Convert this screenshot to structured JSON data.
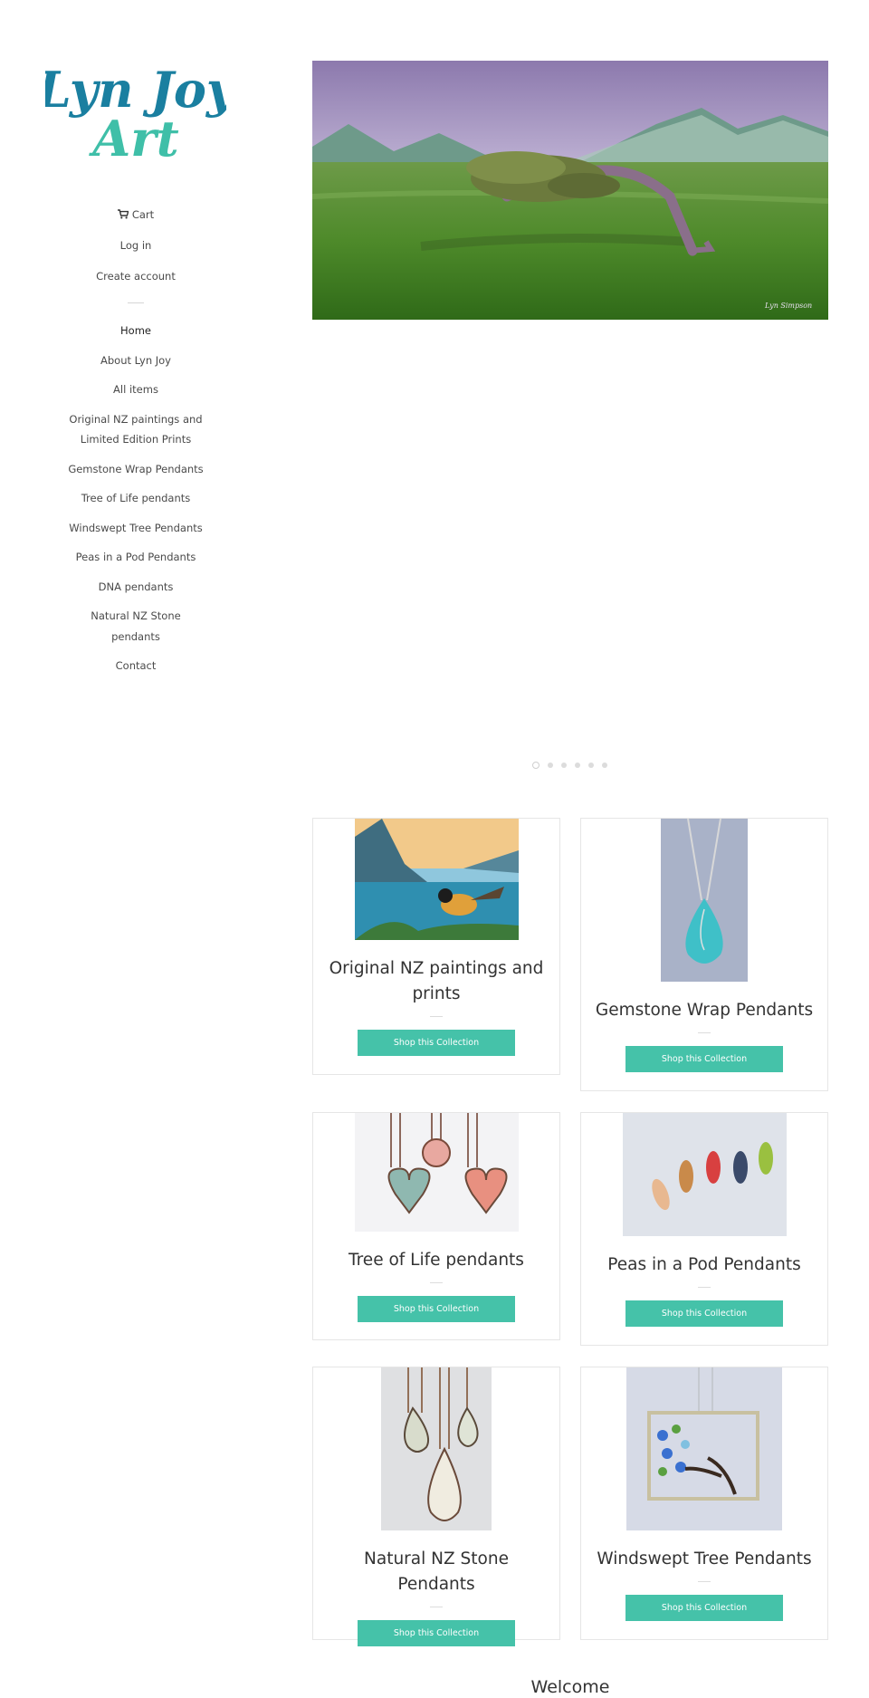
{
  "logo": {
    "line1": "Lyn Joy",
    "line2": "Art"
  },
  "account_links": [
    {
      "label": "Cart",
      "icon": "cart-icon"
    },
    {
      "label": "Log in"
    },
    {
      "label": "Create account"
    }
  ],
  "nav": [
    {
      "label": "Home",
      "active": true
    },
    {
      "label": "About Lyn Joy"
    },
    {
      "label": "All items"
    },
    {
      "label": "Original NZ paintings and Limited Edition Prints"
    },
    {
      "label": "Gemstone Wrap Pendants"
    },
    {
      "label": "Tree of Life pendants"
    },
    {
      "label": "Windswept Tree Pendants"
    },
    {
      "label": "Peas in a Pod Pendants"
    },
    {
      "label": "DNA pendants"
    },
    {
      "label": "Natural NZ Stone pendants"
    },
    {
      "label": "Contact"
    }
  ],
  "hero": {
    "signature": "Lyn Simpson",
    "slide_count": 6,
    "active_slide": 1
  },
  "collections": [
    {
      "title": "Original NZ paintings and prints",
      "button": "Shop this Collection"
    },
    {
      "title": "Gemstone Wrap Pendants",
      "button": "Shop this Collection"
    },
    {
      "title": "Tree of Life pendants",
      "button": "Shop this Collection"
    },
    {
      "title": "Peas in a Pod Pendants",
      "button": "Shop this Collection"
    },
    {
      "title": "Natural NZ Stone Pendants",
      "button": "Shop this Collection"
    },
    {
      "title": "Windswept Tree Pendants",
      "button": "Shop this Collection"
    }
  ],
  "welcome": "Welcome",
  "colors": {
    "accent": "#45c2a9",
    "logo_blue": "#1a7fa0",
    "logo_teal": "#3fbfa8"
  }
}
